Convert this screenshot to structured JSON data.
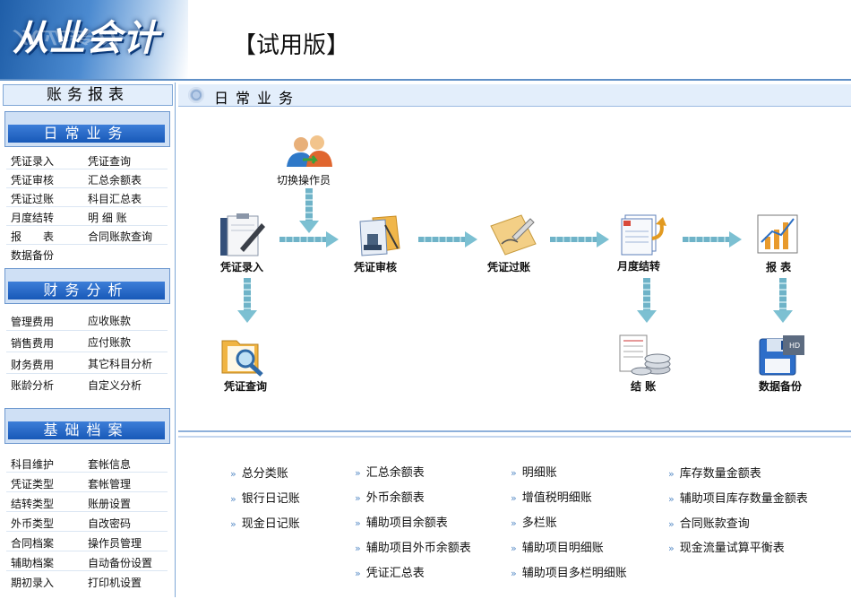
{
  "header": {
    "logo_text": "从业会计",
    "trial_label": "【试用版】"
  },
  "sidebar": {
    "title": "账务报表",
    "sections": [
      {
        "title": "日常业务",
        "items": [
          "凭证录入",
          "凭证查询",
          "凭证审核",
          "汇总余额表",
          "凭证过账",
          "科目汇总表",
          "月度结转",
          "明 细 账",
          "报　　表",
          "合同账款查询",
          "数据备份"
        ]
      },
      {
        "title": "财务分析",
        "items": [
          "管理费用",
          "应收账款",
          "销售费用",
          "应付账款",
          "财务费用",
          "其它科目分析",
          "账龄分析",
          "自定义分析"
        ]
      },
      {
        "title": "基础档案",
        "items": [
          "科目维护",
          "套帐信息",
          "凭证类型",
          "套帐管理",
          "结转类型",
          "账册设置",
          "外币类型",
          "自改密码",
          "合同档案",
          "操作员管理",
          "辅助档案",
          "自动备份设置",
          "期初录入",
          "打印机设置"
        ]
      }
    ]
  },
  "main": {
    "title": "日常业务",
    "flow_nodes": {
      "switch_operator": "切换操作员",
      "voucher_entry": "凭证录入",
      "voucher_review": "凭证审核",
      "voucher_posting": "凭证过账",
      "month_end": "月度结转",
      "reports": "报  表",
      "voucher_query": "凭证查询",
      "close_books": "结  账",
      "data_backup": "数据备份"
    },
    "report_links": [
      [
        "总分类账",
        "银行日记账",
        "现金日记账"
      ],
      [
        "汇总余额表",
        "外币余额表",
        "辅助项目余额表",
        "辅助项目外币余额表",
        "凭证汇总表"
      ],
      [
        "明细账",
        "增值税明细账",
        "多栏账",
        "辅助项目明细账",
        "辅助项目多栏明细账"
      ],
      [
        "库存数量金额表",
        "辅助项目库存数量金额表",
        "合同账款查询",
        "现金流量试算平衡表"
      ]
    ]
  },
  "colors": {
    "accent_blue": "#1859b8",
    "panel_light": "#e3eefb",
    "arrow": "#7cc0d2"
  }
}
